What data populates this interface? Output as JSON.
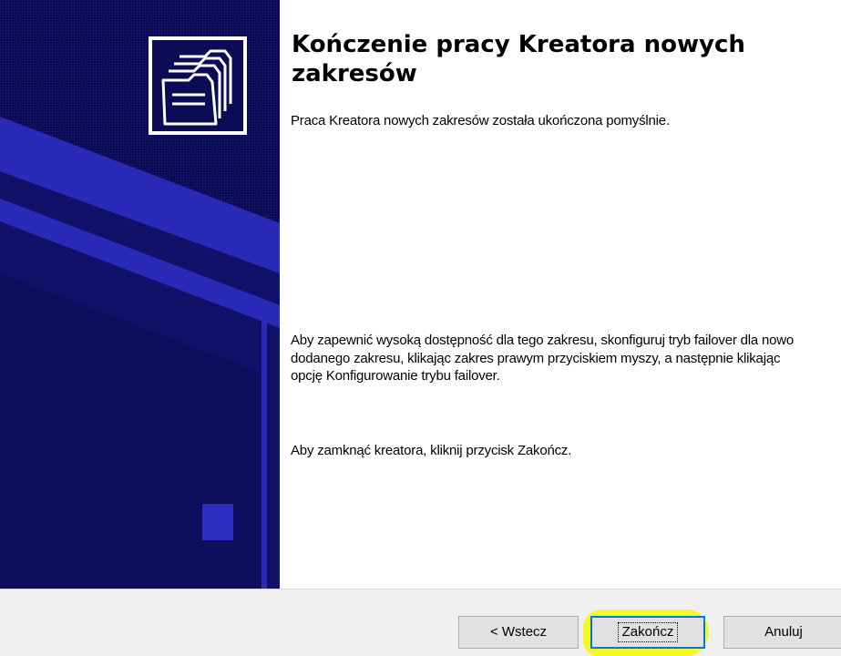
{
  "wizard": {
    "title": "Kończenie pracy Kreatora nowych zakresów",
    "intro": "Praca Kreatora nowych zakresów została ukończona pomyślnie.",
    "failover_note": "Aby zapewnić wysoką dostępność dla tego zakresu, skonfiguruj tryb failover dla nowo dodanego zakresu, klikając zakres prawym przyciskiem myszy, a następnie klikając opcję Konfigurowanie trybu failover.",
    "close_note": "Aby zamknąć kreatora, kliknij przycisk Zakończ."
  },
  "buttons": {
    "back_label": "< Wstecz",
    "finish_label": "Zakończ",
    "cancel_label": "Anuluj"
  },
  "banner": {
    "icon": "folders-icon",
    "colors": {
      "background": "#0c0c56",
      "accent": "#2a2ab8"
    }
  },
  "annotation": {
    "highlight_color": "#f4f71b"
  }
}
